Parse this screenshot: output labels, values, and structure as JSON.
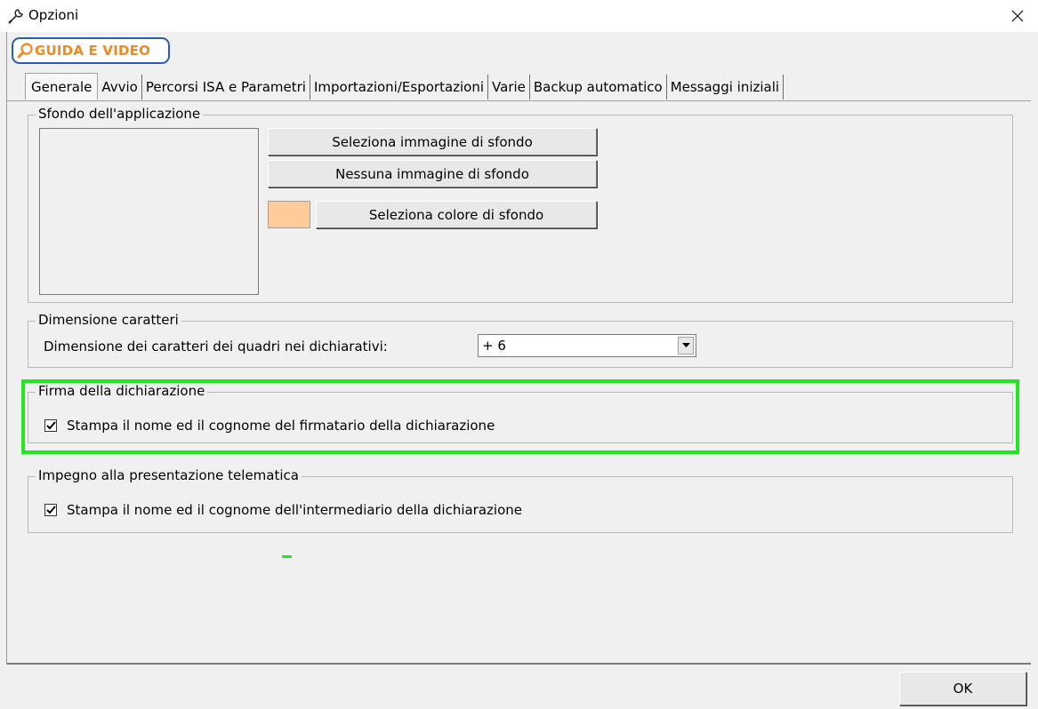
{
  "window": {
    "title": "Opzioni",
    "close_symbol": "✕"
  },
  "guida": {
    "label": "GUIDA E VIDEO"
  },
  "tabs": [
    {
      "label": "Generale",
      "active": true
    },
    {
      "label": "Avvio",
      "active": false
    },
    {
      "label": "Percorsi ISA e Parametri",
      "active": false
    },
    {
      "label": "Importazioni/Esportazioni",
      "active": false
    },
    {
      "label": "Varie",
      "active": false
    },
    {
      "label": "Backup automatico",
      "active": false
    },
    {
      "label": "Messaggi iniziali",
      "active": false
    }
  ],
  "sfondo": {
    "legend": "Sfondo dell'applicazione",
    "select_image_label": "Seleziona immagine di sfondo",
    "no_image_label": "Nessuna immagine di sfondo",
    "select_color_label": "Seleziona colore di sfondo",
    "color_value": "#ffcc99"
  },
  "dimensione": {
    "legend": "Dimensione caratteri",
    "row_label": "Dimensione dei caratteri dei quadri nei dichiarativi:",
    "selected_value": "+ 6"
  },
  "firma": {
    "legend": "Firma della dichiarazione",
    "checkbox_label": "Stampa il nome ed il cognome del firmatario della dichiarazione",
    "checked": true
  },
  "impegno": {
    "legend": "Impegno alla presentazione telematica",
    "checkbox_label": "Stampa il nome ed il cognome dell'intermediario della dichiarazione",
    "checked": true
  },
  "footer": {
    "ok_label": "OK"
  },
  "colors": {
    "highlight": "#22e622",
    "guida_border": "#2a5db0",
    "guida_text": "#f08a1e"
  }
}
